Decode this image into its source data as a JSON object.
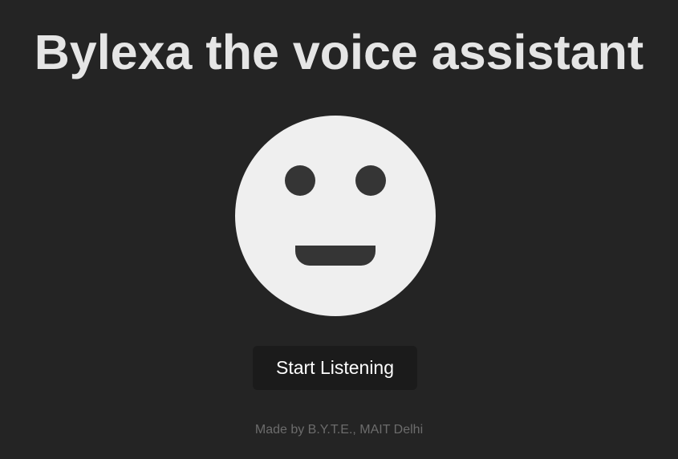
{
  "header": {
    "title": "Bylexa the voice assistant"
  },
  "face": {
    "icon": "smiley-face-icon",
    "face_color": "#efefef",
    "feature_color": "#353535"
  },
  "controls": {
    "start_label": "Start Listening",
    "button_color": "#1b1b1b"
  },
  "footer": {
    "credit": "Made by B.Y.T.E., MAIT Delhi"
  },
  "colors": {
    "background": "#242424",
    "title": "#e5e5e5",
    "footer_text": "#6c6c6c"
  }
}
